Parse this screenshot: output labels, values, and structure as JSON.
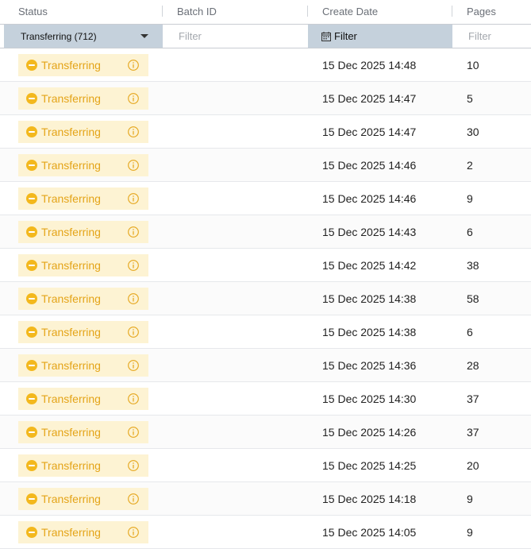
{
  "columns": {
    "status": "Status",
    "batch_id": "Batch ID",
    "create_date": "Create Date",
    "pages": "Pages"
  },
  "filters": {
    "status_selected": "Transferring (712)",
    "batch_id_placeholder": "Filter",
    "create_date_label": "Filter",
    "pages_placeholder": "Filter"
  },
  "rows": [
    {
      "status": "Transferring",
      "batch_id": "",
      "create_date": "15 Dec 2025 14:48",
      "pages": "10"
    },
    {
      "status": "Transferring",
      "batch_id": "",
      "create_date": "15 Dec 2025 14:47",
      "pages": "5"
    },
    {
      "status": "Transferring",
      "batch_id": "",
      "create_date": "15 Dec 2025 14:47",
      "pages": "30"
    },
    {
      "status": "Transferring",
      "batch_id": "",
      "create_date": "15 Dec 2025 14:46",
      "pages": "2"
    },
    {
      "status": "Transferring",
      "batch_id": "",
      "create_date": "15 Dec 2025 14:46",
      "pages": "9"
    },
    {
      "status": "Transferring",
      "batch_id": "",
      "create_date": "15 Dec 2025 14:43",
      "pages": "6"
    },
    {
      "status": "Transferring",
      "batch_id": "",
      "create_date": "15 Dec 2025 14:42",
      "pages": "38"
    },
    {
      "status": "Transferring",
      "batch_id": "",
      "create_date": "15 Dec 2025 14:38",
      "pages": "58"
    },
    {
      "status": "Transferring",
      "batch_id": "",
      "create_date": "15 Dec 2025 14:38",
      "pages": "6"
    },
    {
      "status": "Transferring",
      "batch_id": "",
      "create_date": "15 Dec 2025 14:36",
      "pages": "28"
    },
    {
      "status": "Transferring",
      "batch_id": "",
      "create_date": "15 Dec 2025 14:30",
      "pages": "37"
    },
    {
      "status": "Transferring",
      "batch_id": "",
      "create_date": "15 Dec 2025 14:26",
      "pages": "37"
    },
    {
      "status": "Transferring",
      "batch_id": "",
      "create_date": "15 Dec 2025 14:25",
      "pages": "20"
    },
    {
      "status": "Transferring",
      "batch_id": "",
      "create_date": "15 Dec 2025 14:18",
      "pages": "9"
    },
    {
      "status": "Transferring",
      "batch_id": "",
      "create_date": "15 Dec 2025 14:05",
      "pages": "9"
    }
  ],
  "icons": {
    "status_icon": "minus-circle-icon",
    "info_icon": "info-icon",
    "date_filter_icon": "calendar-icon",
    "dropdown_icon": "caret-down-icon"
  },
  "colors": {
    "status_text": "#e4a418",
    "status_chip_bg": "#fdf3d3",
    "status_icon": "#f3b81d",
    "active_filter_bg": "#c5d1dc",
    "header_text": "#6a6f77"
  }
}
